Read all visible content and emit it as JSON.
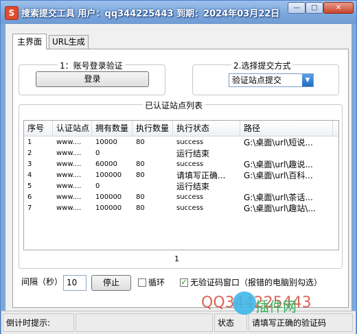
{
  "window": {
    "title": "搜索提交工具 用户：qq344225443 到期：2024年03月22日",
    "app_icon_glyph": "S",
    "min_glyph": "—",
    "max_glyph": "□",
    "close_glyph": "✕"
  },
  "tabs": [
    {
      "label": "主界面"
    },
    {
      "label": "URL生成"
    }
  ],
  "login_group": {
    "title": "1：账号登录验证",
    "button": "登录"
  },
  "submit_group": {
    "title": "2.选择提交方式",
    "selected": "验证站点提交"
  },
  "sites_group": {
    "title": "已认证站点列表",
    "columns": [
      "序号",
      "认证站点",
      "拥有数量",
      "执行数量",
      "执行状态",
      "路径"
    ],
    "rows": [
      [
        "1",
        "www....",
        "10000",
        "80",
        "success",
        "G:\\桌面\\url\\短说..."
      ],
      [
        "2",
        "www....",
        "0",
        "",
        "运行结束",
        ""
      ],
      [
        "3",
        "www....",
        "60000",
        "80",
        "success",
        "G:\\桌面\\url\\趣说..."
      ],
      [
        "4",
        "www....",
        "100000",
        "80",
        "请填写正确...",
        "G:\\桌面\\url\\百科..."
      ],
      [
        "5",
        "www....",
        "0",
        "",
        "运行结束",
        ""
      ],
      [
        "6",
        "www....",
        "100000",
        "80",
        "success",
        "G:\\桌面\\url\\茶话..."
      ],
      [
        "7",
        "www....",
        "100000",
        "80",
        "success",
        "G:\\桌面\\url\\趣站\\..."
      ]
    ],
    "page": "1"
  },
  "controls": {
    "interval_label": "间隔（秒）",
    "interval_value": "10",
    "stop_button": "停止",
    "loop_label": "循环",
    "loop_checked": false,
    "no_captcha_label": "无验证码窗口（报错的电脑别勾选）",
    "no_captcha_checked": true,
    "check_glyph": "✓"
  },
  "statusbar": {
    "countdown_label": "倒计时提示:",
    "status_label": "状态",
    "status_value": "请填写正确的验证码"
  },
  "watermark": {
    "qq": "QQ344225443",
    "site": "插件网"
  }
}
